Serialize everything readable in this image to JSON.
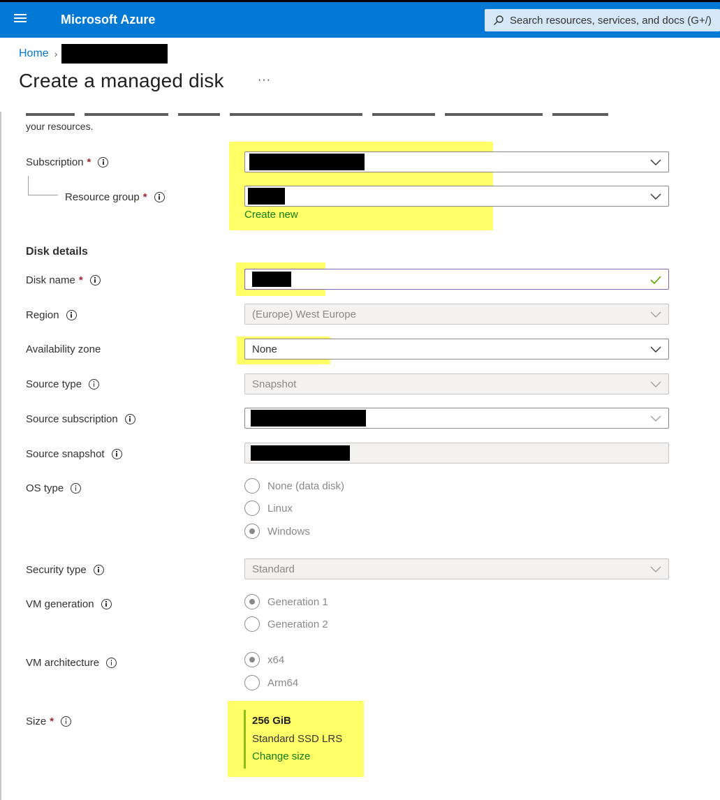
{
  "topbar": {
    "brand": "Microsoft Azure",
    "search_placeholder": "Search resources, services, and docs (G+/)"
  },
  "breadcrumb": {
    "home": "Home"
  },
  "page": {
    "title": "Create a managed disk",
    "more": "···"
  },
  "intro_text": "your resources.",
  "basics": {
    "subscription_label": "Subscription",
    "resource_group_label": "Resource group",
    "create_new": "Create new",
    "required_mark": "*"
  },
  "disk_details": {
    "section_title": "Disk details",
    "disk_name_label": "Disk name",
    "region_label": "Region",
    "region_value": "(Europe) West Europe",
    "availability_zone_label": "Availability zone",
    "availability_zone_value": "None",
    "source_type_label": "Source type",
    "source_type_value": "Snapshot",
    "source_subscription_label": "Source subscription",
    "source_snapshot_label": "Source snapshot",
    "os_type_label": "OS type",
    "os_type_options": [
      "None (data disk)",
      "Linux",
      "Windows"
    ],
    "os_type_selected": "Windows",
    "security_type_label": "Security type",
    "security_type_value": "Standard",
    "vm_generation_label": "VM generation",
    "vm_generation_options": [
      "Generation 1",
      "Generation 2"
    ],
    "vm_generation_selected": "Generation 1",
    "vm_architecture_label": "VM architecture",
    "vm_architecture_options": [
      "x64",
      "Arm64"
    ],
    "vm_architecture_selected": "x64",
    "size_label": "Size",
    "size_value": "256 GiB",
    "size_sku": "Standard SSD LRS",
    "change_size": "Change size"
  },
  "colors": {
    "azure_blue": "#0078d4",
    "highlight": "#ffff4d",
    "link_green": "#107c10",
    "required_red": "#a4262c",
    "valid_check": "#57a300"
  }
}
